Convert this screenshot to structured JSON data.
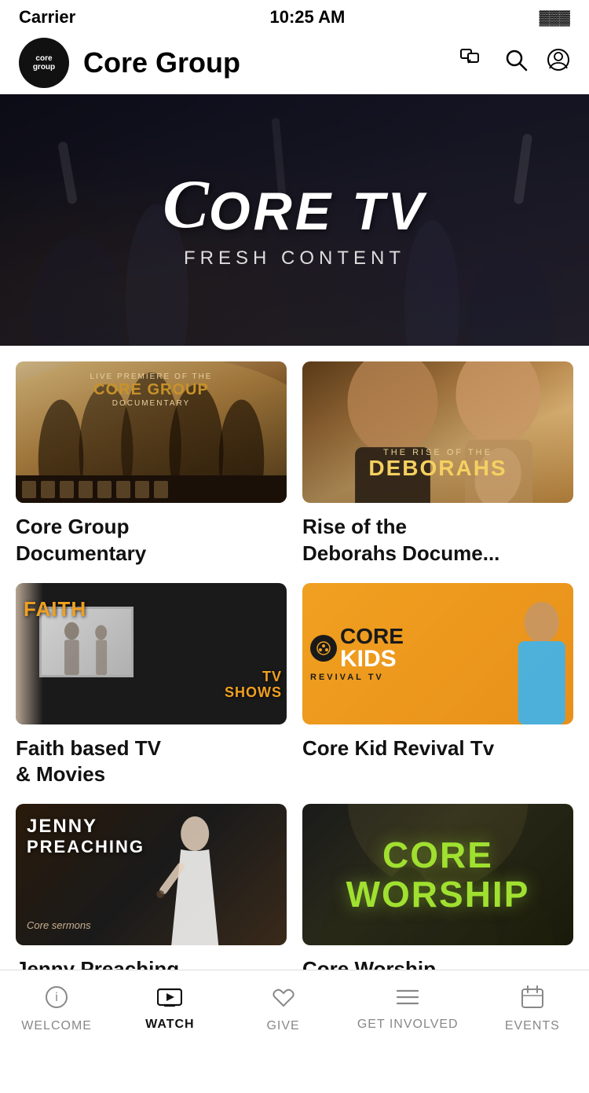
{
  "statusBar": {
    "carrier": "Carrier",
    "time": "10:25 AM",
    "battery": "🔋"
  },
  "header": {
    "logoText": "core\ngroup",
    "title": "Core Group",
    "chatIcon": "💬",
    "searchIcon": "🔍",
    "profileIcon": "👤"
  },
  "hero": {
    "logoLine1": "Core TV",
    "subtitle": "FRESH CONTENT"
  },
  "cards": [
    {
      "id": "card-1",
      "label": "Core Group\nDocumentary",
      "labelLine1": "Core Group",
      "labelLine2": "Documentary"
    },
    {
      "id": "card-2",
      "label": "Rise of the\nDeborahs Docume...",
      "labelLine1": "Rise of the",
      "labelLine2": "Deborahs Docume..."
    },
    {
      "id": "card-3",
      "label": "Faith based TV\n& Movies",
      "labelLine1": "Faith based TV",
      "labelLine2": "& Movies"
    },
    {
      "id": "card-4",
      "label": "Core Kid Revival Tv",
      "labelLine1": "Core Kid Revival Tv",
      "labelLine2": ""
    },
    {
      "id": "card-5",
      "label": "Jenny Preaching",
      "labelLine1": "Jenny Preaching",
      "labelLine2": ""
    },
    {
      "id": "card-6",
      "label": "Core Worship",
      "labelLine1": "Core Worship",
      "labelLine2": ""
    }
  ],
  "tabBar": {
    "tabs": [
      {
        "id": "welcome",
        "label": "WELCOME",
        "icon": "ℹ",
        "active": false
      },
      {
        "id": "watch",
        "label": "WATCH",
        "icon": "▶",
        "active": true
      },
      {
        "id": "give",
        "label": "GIVE",
        "icon": "❤",
        "active": false
      },
      {
        "id": "get-involved",
        "label": "GET INVOLVED",
        "icon": "☰",
        "active": false
      },
      {
        "id": "events",
        "label": "EVENTS",
        "icon": "📅",
        "active": false
      }
    ]
  }
}
